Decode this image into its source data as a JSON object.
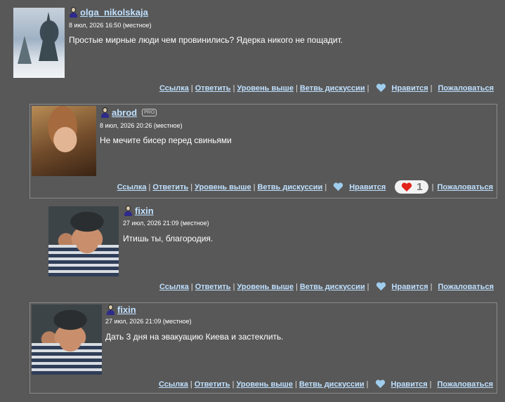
{
  "action_labels": {
    "link": "Ссылка",
    "reply": "Ответить",
    "parent": "Уровень выше",
    "thread": "Ветвь дискуссии",
    "like": "Нравится",
    "report": "Пожаловаться",
    "separator": "|"
  },
  "pro_badge": "PRO",
  "colors": {
    "background": "#585858",
    "link": "#bfe0ff",
    "like_heart": "#9fcdee",
    "liked_heart": "#e2231a"
  },
  "comments": [
    {
      "username": "olga_nikolskaja",
      "date": "8 июл, 2026 16:50 (местное)",
      "text": "Простые мирные люди чем провинились? Ядерка никого не пощадит.",
      "avatar": "snowy-trees-photo"
    },
    {
      "username": "abrod",
      "date": "8 июл, 2026 20:26 (местное)",
      "text": "Не мечите бисер перед свиньями",
      "avatar": "renaissance-portrait",
      "likes": "1"
    },
    {
      "username": "fixin",
      "date": "27 июл, 2026 21:09 (местное)",
      "text": "Итишь ты, благородия.",
      "avatar": "man-in-helmet-photo"
    },
    {
      "username": "fixin",
      "date": "27 июл, 2026 21:09 (местное)",
      "text": "Дать 3 дня на эвакуацию Киева и застеклить.",
      "avatar": "man-in-helmet-photo"
    }
  ]
}
